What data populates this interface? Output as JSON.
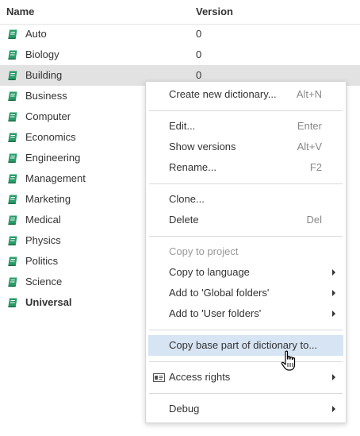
{
  "columns": {
    "name": "Name",
    "version": "Version"
  },
  "rows": [
    {
      "name": "Auto",
      "version": "0"
    },
    {
      "name": "Biology",
      "version": "0"
    },
    {
      "name": "Building",
      "version": "0"
    },
    {
      "name": "Business",
      "version": ""
    },
    {
      "name": "Computer",
      "version": ""
    },
    {
      "name": "Economics",
      "version": ""
    },
    {
      "name": "Engineering",
      "version": ""
    },
    {
      "name": "Management",
      "version": ""
    },
    {
      "name": "Marketing",
      "version": ""
    },
    {
      "name": "Medical",
      "version": ""
    },
    {
      "name": "Physics",
      "version": ""
    },
    {
      "name": "Politics",
      "version": ""
    },
    {
      "name": "Science",
      "version": ""
    },
    {
      "name": "Universal",
      "version": ""
    }
  ],
  "selected_row": "Building",
  "context_menu": {
    "create_new": {
      "label": "Create new dictionary...",
      "shortcut": "Alt+N"
    },
    "edit": {
      "label": "Edit...",
      "shortcut": "Enter"
    },
    "show_versions": {
      "label": "Show versions",
      "shortcut": "Alt+V"
    },
    "rename": {
      "label": "Rename...",
      "shortcut": "F2"
    },
    "clone": {
      "label": "Clone..."
    },
    "delete": {
      "label": "Delete",
      "shortcut": "Del"
    },
    "copy_to_project": {
      "label": "Copy to project"
    },
    "copy_to_language": {
      "label": "Copy to language"
    },
    "add_global": {
      "label": "Add to 'Global folders'"
    },
    "add_user": {
      "label": "Add to 'User folders'"
    },
    "copy_base": {
      "label": "Copy base part of dictionary to..."
    },
    "access_rights": {
      "label": "Access rights"
    },
    "debug": {
      "label": "Debug"
    }
  },
  "icons": {
    "dictionary": "book-icon",
    "access": "id-card-icon",
    "cursor": "hand-pointer-icon"
  },
  "colors": {
    "book": "#2a9d6a",
    "highlight": "#d6e4f3",
    "selected_row": "#e2e2e2"
  }
}
